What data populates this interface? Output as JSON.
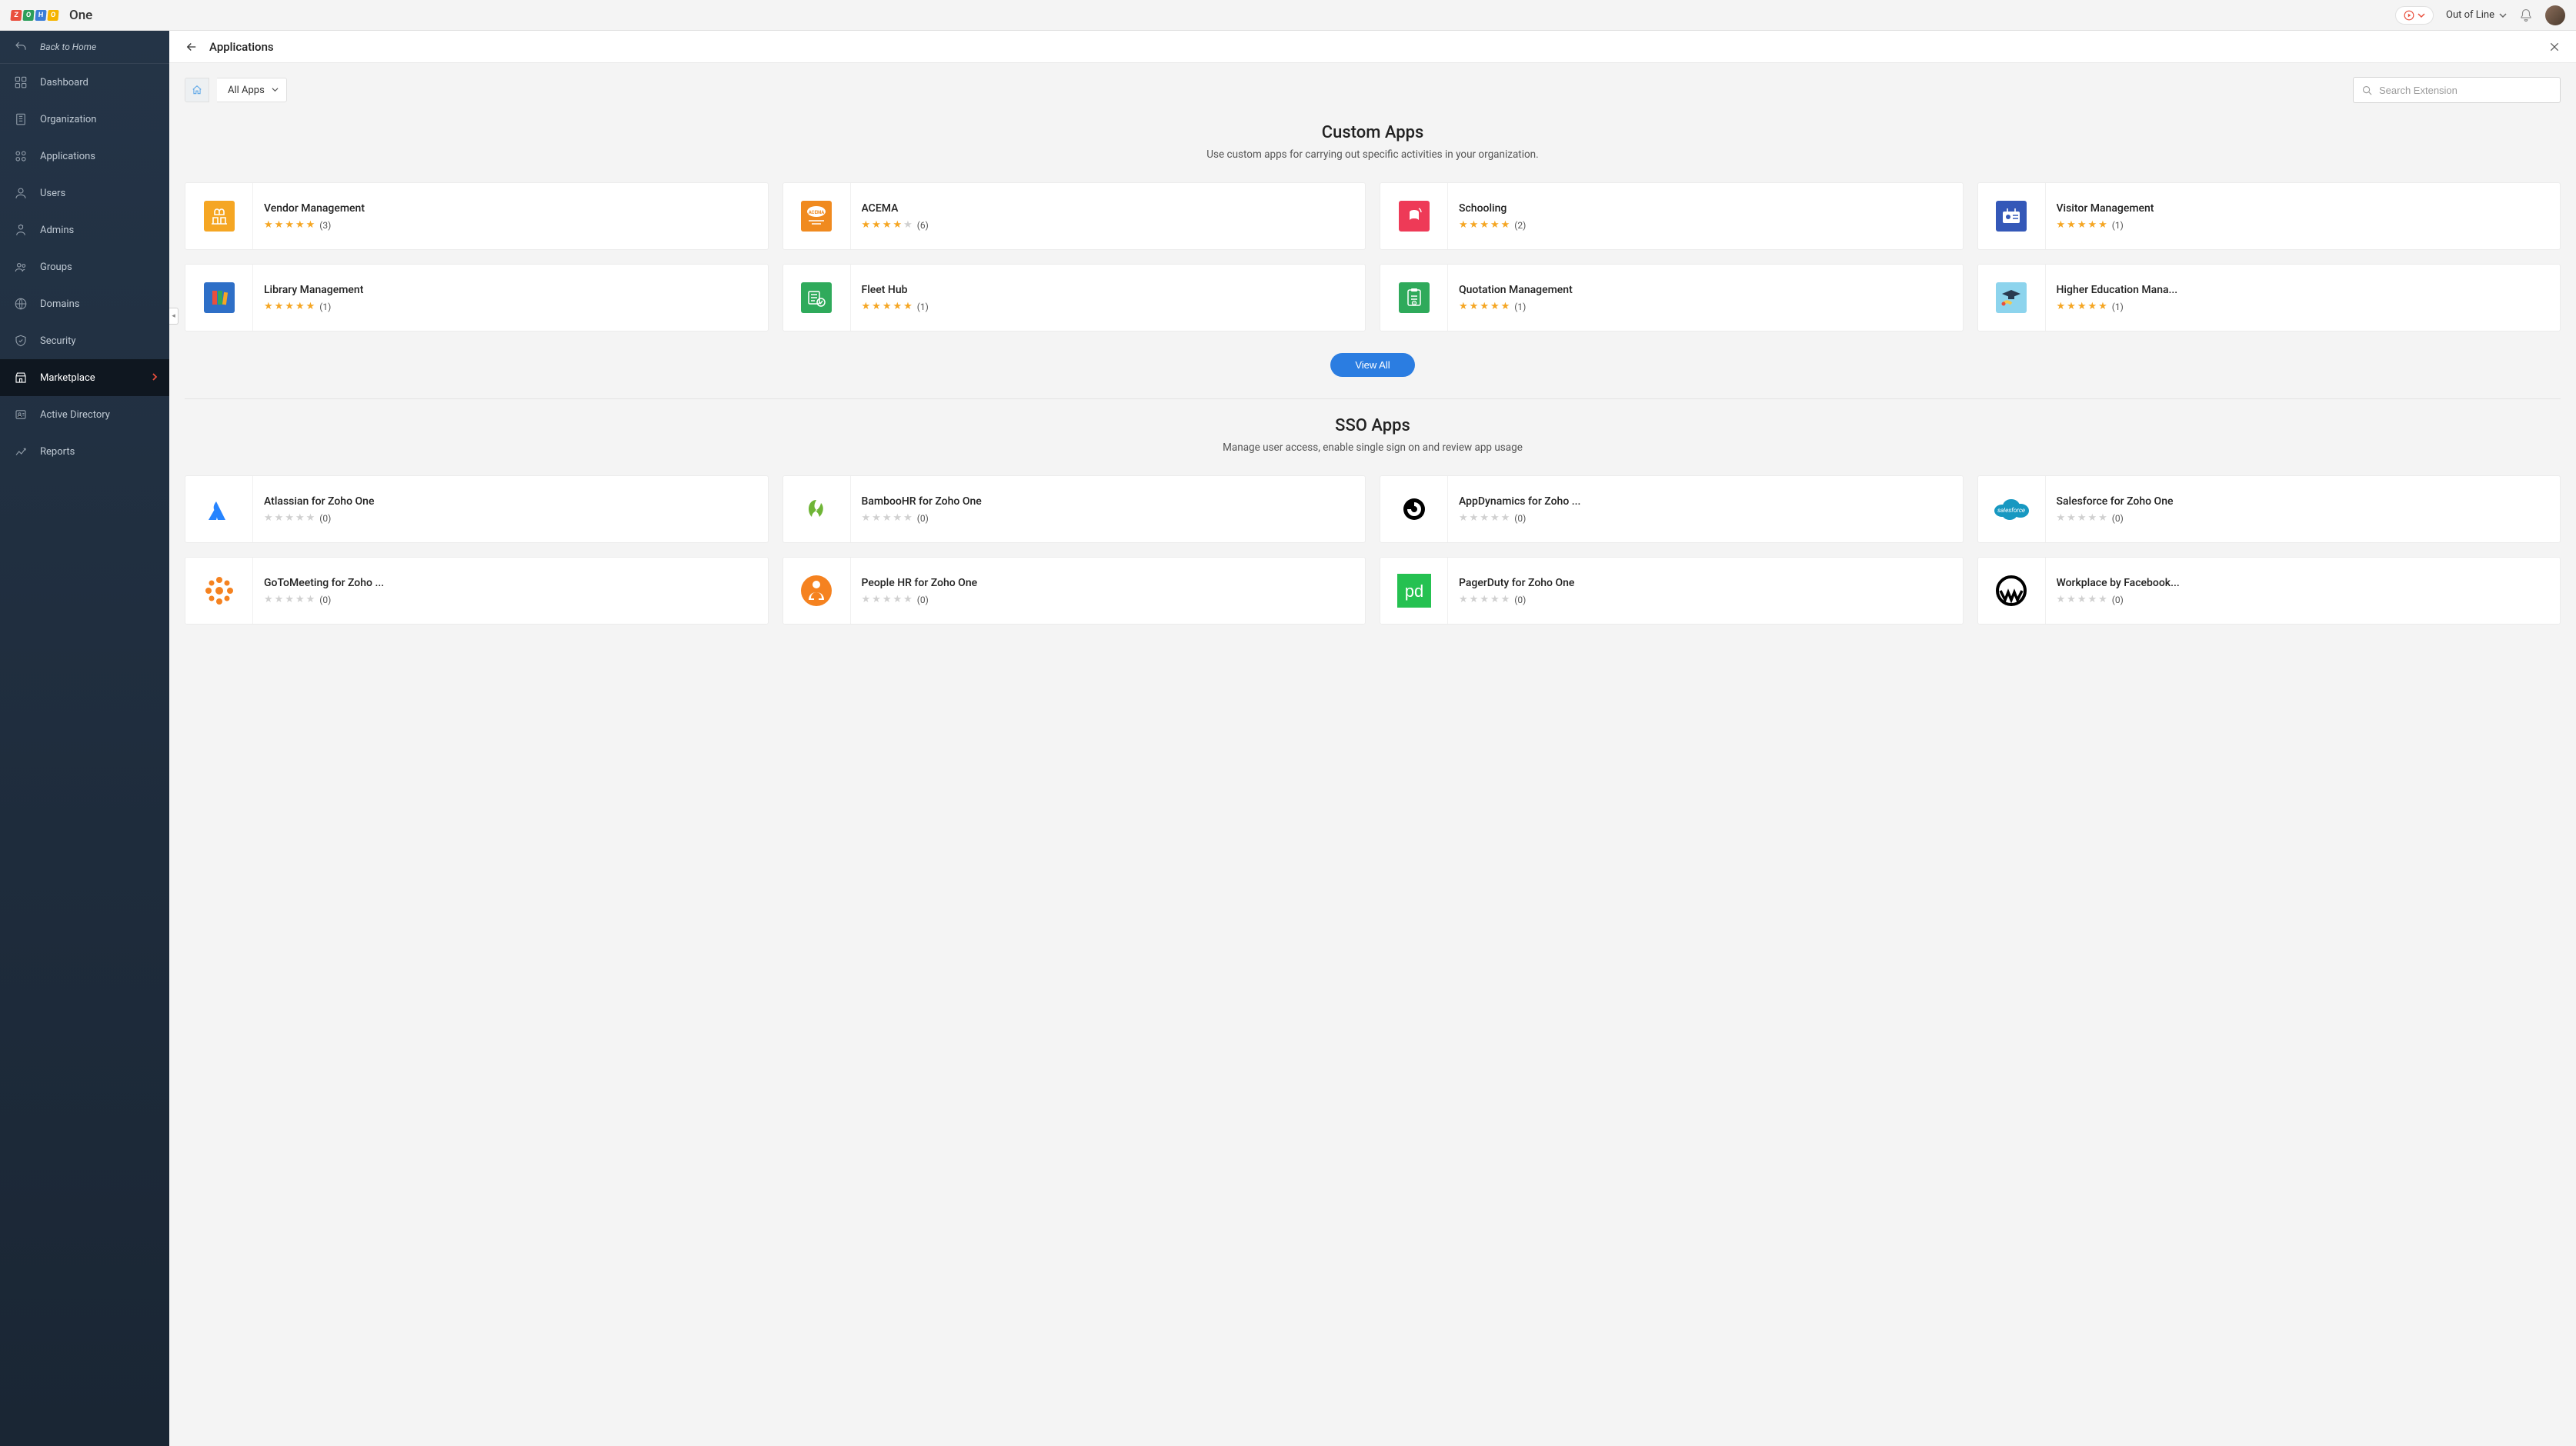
{
  "brand": {
    "name": "One"
  },
  "header": {
    "workspace": "Out of Line"
  },
  "sidebar": {
    "back": "Back to Home",
    "items": [
      {
        "label": "Dashboard"
      },
      {
        "label": "Organization"
      },
      {
        "label": "Applications"
      },
      {
        "label": "Users"
      },
      {
        "label": "Admins"
      },
      {
        "label": "Groups"
      },
      {
        "label": "Domains"
      },
      {
        "label": "Security"
      },
      {
        "label": "Marketplace"
      },
      {
        "label": "Active Directory"
      },
      {
        "label": "Reports"
      }
    ]
  },
  "page": {
    "title": "Applications",
    "filter_label": "All Apps",
    "search_placeholder": "Search Extension"
  },
  "custom_apps": {
    "title": "Custom Apps",
    "subtitle": "Use custom apps for carrying out specific activities in your organization.",
    "view_all": "View All",
    "items": [
      {
        "name": "Vendor Management",
        "rating": 5,
        "count": 3,
        "tile": "t-vendor"
      },
      {
        "name": "ACEMA",
        "rating": 4,
        "count": 6,
        "tile": "t-acema"
      },
      {
        "name": "Schooling",
        "rating": 5,
        "count": 2,
        "tile": "t-school"
      },
      {
        "name": "Visitor Management",
        "rating": 5,
        "count": 1,
        "tile": "t-visitor"
      },
      {
        "name": "Library Management",
        "rating": 5,
        "count": 1,
        "tile": "t-library"
      },
      {
        "name": "Fleet Hub",
        "rating": 5,
        "count": 1,
        "tile": "t-fleet"
      },
      {
        "name": "Quotation Management",
        "rating": 5,
        "count": 1,
        "tile": "t-quote"
      },
      {
        "name": "Higher Education Mana...",
        "rating": 5,
        "count": 1,
        "tile": "t-higher"
      }
    ]
  },
  "sso_apps": {
    "title": "SSO Apps",
    "subtitle": "Manage user access, enable single sign on and review app usage",
    "items": [
      {
        "name": "Atlassian for Zoho One",
        "rating": 0,
        "count": 0,
        "tile": "t-atlassian"
      },
      {
        "name": "BambooHR for Zoho One",
        "rating": 0,
        "count": 0,
        "tile": "t-bamboo"
      },
      {
        "name": "AppDynamics for Zoho ...",
        "rating": 0,
        "count": 0,
        "tile": "t-appd"
      },
      {
        "name": "Salesforce for Zoho One",
        "rating": 0,
        "count": 0,
        "tile": "t-sf"
      },
      {
        "name": "GoToMeeting for Zoho ...",
        "rating": 0,
        "count": 0,
        "tile": "t-goto"
      },
      {
        "name": "People HR for Zoho One",
        "rating": 0,
        "count": 0,
        "tile": "t-people"
      },
      {
        "name": "PagerDuty for Zoho One",
        "rating": 0,
        "count": 0,
        "tile": "t-pager"
      },
      {
        "name": "Workplace by Facebook...",
        "rating": 0,
        "count": 0,
        "tile": "t-work"
      }
    ]
  }
}
